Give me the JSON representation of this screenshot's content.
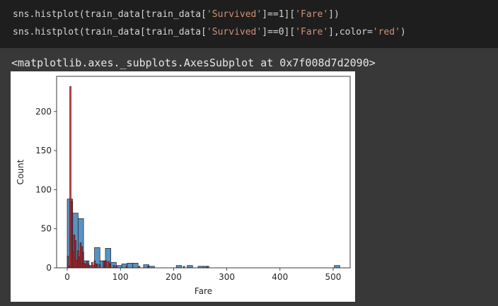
{
  "code": {
    "line1": {
      "prefix": "sns.histplot(train_data[train_data[",
      "str1": "'Survived'",
      "mid": "]==1][",
      "str2": "'Fare'",
      "suffix": "])"
    },
    "line2": {
      "prefix": "sns.histplot(train_data[train_data[",
      "str1": "'Survived'",
      "mid": "]==0][",
      "str2": "'Fare'",
      "mid2": "],color=",
      "str3": "'red'",
      "suffix": ")"
    }
  },
  "output": {
    "text": "<matplotlib.axes._subplots.AxesSubplot at 0x7f008d7d2090>"
  },
  "chart_data": {
    "type": "bar",
    "xlabel": "Fare",
    "ylabel": "Count",
    "xlim": [
      -20,
      532
    ],
    "ylim": [
      0,
      245
    ],
    "xticks": [
      0,
      100,
      200,
      300,
      400,
      500
    ],
    "yticks": [
      0,
      50,
      100,
      150,
      200
    ],
    "grid": false,
    "series": [
      {
        "color": "#3a80b8",
        "bins": [
          {
            "x0": 0,
            "x1": 10.25,
            "y": 88
          },
          {
            "x0": 10.25,
            "x1": 20.5,
            "y": 70
          },
          {
            "x0": 20.5,
            "x1": 30.75,
            "y": 63
          },
          {
            "x0": 30.75,
            "x1": 41.0,
            "y": 9
          },
          {
            "x0": 41.0,
            "x1": 51.25,
            "y": 3
          },
          {
            "x0": 51.25,
            "x1": 61.5,
            "y": 26
          },
          {
            "x0": 61.5,
            "x1": 71.75,
            "y": 9
          },
          {
            "x0": 71.75,
            "x1": 82.0,
            "y": 25
          },
          {
            "x0": 82.0,
            "x1": 92.25,
            "y": 7
          },
          {
            "x0": 92.25,
            "x1": 102.5,
            "y": 3
          },
          {
            "x0": 102.5,
            "x1": 112.75,
            "y": 5
          },
          {
            "x0": 112.75,
            "x1": 123.0,
            "y": 6
          },
          {
            "x0": 123.0,
            "x1": 133.25,
            "y": 6
          },
          {
            "x0": 143.5,
            "x1": 153.75,
            "y": 4
          },
          {
            "x0": 153.75,
            "x1": 164.0,
            "y": 2
          },
          {
            "x0": 205.0,
            "x1": 215.25,
            "y": 3
          },
          {
            "x0": 225.5,
            "x1": 235.75,
            "y": 3
          },
          {
            "x0": 246.0,
            "x1": 256.25,
            "y": 2
          },
          {
            "x0": 256.25,
            "x1": 266.5,
            "y": 2
          },
          {
            "x0": 502.25,
            "x1": 512.5,
            "y": 3
          }
        ]
      },
      {
        "color": "#e0191c",
        "bins": [
          {
            "x0": 0,
            "x1": 2.4,
            "y": 15
          },
          {
            "x0": 2.4,
            "x1": 4.8,
            "y": 2
          },
          {
            "x0": 4.8,
            "x1": 7.2,
            "y": 232
          },
          {
            "x0": 7.2,
            "x1": 9.6,
            "y": 85
          },
          {
            "x0": 9.6,
            "x1": 12.0,
            "y": 20
          },
          {
            "x0": 12.0,
            "x1": 14.4,
            "y": 42
          },
          {
            "x0": 14.4,
            "x1": 16.8,
            "y": 35
          },
          {
            "x0": 16.8,
            "x1": 19.2,
            "y": 10
          },
          {
            "x0": 19.2,
            "x1": 21.6,
            "y": 22
          },
          {
            "x0": 21.6,
            "x1": 24.0,
            "y": 14
          },
          {
            "x0": 24.0,
            "x1": 26.4,
            "y": 32
          },
          {
            "x0": 26.4,
            "x1": 28.8,
            "y": 27
          },
          {
            "x0": 28.8,
            "x1": 31.2,
            "y": 20
          },
          {
            "x0": 31.2,
            "x1": 33.6,
            "y": 6
          },
          {
            "x0": 33.6,
            "x1": 36.0,
            "y": 4
          },
          {
            "x0": 36.0,
            "x1": 38.4,
            "y": 8
          },
          {
            "x0": 38.4,
            "x1": 40.8,
            "y": 5
          },
          {
            "x0": 40.8,
            "x1": 43.2,
            "y": 3
          },
          {
            "x0": 45.6,
            "x1": 48.0,
            "y": 7
          },
          {
            "x0": 50.4,
            "x1": 52.8,
            "y": 9
          },
          {
            "x0": 52.8,
            "x1": 55.2,
            "y": 5
          },
          {
            "x0": 55.2,
            "x1": 57.6,
            "y": 5
          },
          {
            "x0": 60.0,
            "x1": 62.4,
            "y": 4
          },
          {
            "x0": 67.2,
            "x1": 69.6,
            "y": 9
          },
          {
            "x0": 69.6,
            "x1": 72.0,
            "y": 8
          },
          {
            "x0": 72.0,
            "x1": 74.4,
            "y": 9
          },
          {
            "x0": 76.8,
            "x1": 79.2,
            "y": 8
          },
          {
            "x0": 79.2,
            "x1": 81.6,
            "y": 5
          },
          {
            "x0": 86.4,
            "x1": 88.8,
            "y": 3
          },
          {
            "x0": 91.2,
            "x1": 93.6,
            "y": 2
          },
          {
            "x0": 110.4,
            "x1": 112.8,
            "y": 2
          },
          {
            "x0": 134.4,
            "x1": 136.8,
            "y": 2
          },
          {
            "x0": 151.2,
            "x1": 153.6,
            "y": 2
          },
          {
            "x0": 218.4,
            "x1": 220.8,
            "y": 2
          },
          {
            "x0": 261.6,
            "x1": 264.0,
            "y": 2
          }
        ]
      }
    ]
  }
}
